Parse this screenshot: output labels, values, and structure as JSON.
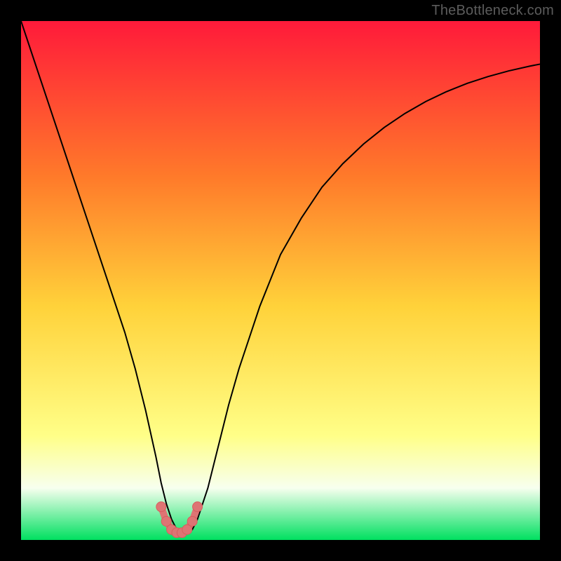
{
  "watermark": "TheBottleneck.com",
  "colors": {
    "frame": "#000000",
    "watermark_text": "#5c5c5c",
    "gradient_top": "#ff1a3a",
    "gradient_mid_upper": "#ff7a2a",
    "gradient_mid": "#ffd23a",
    "gradient_mid_lower": "#ffff88",
    "gradient_lower_band": "#f7ffef",
    "gradient_bottom": "#00e060",
    "curve_main": "#000000",
    "marker_fill": "#de7474",
    "marker_stroke": "#d85e5e"
  },
  "chart_data": {
    "type": "line",
    "title": "",
    "xlabel": "",
    "ylabel": "",
    "xlim": [
      0,
      100
    ],
    "ylim": [
      0,
      100
    ],
    "series": [
      {
        "name": "bottleneck-curve",
        "x": [
          0,
          2,
          4,
          6,
          8,
          10,
          12,
          14,
          16,
          18,
          20,
          22,
          24,
          26,
          27,
          28,
          29,
          30,
          31,
          32,
          33,
          34,
          36,
          38,
          40,
          42,
          44,
          46,
          48,
          50,
          54,
          58,
          62,
          66,
          70,
          74,
          78,
          82,
          86,
          90,
          94,
          98,
          100
        ],
        "y": [
          100,
          94,
          88,
          82,
          76,
          70,
          64,
          58,
          52,
          46,
          40,
          33,
          25,
          16,
          11,
          7,
          4,
          2,
          1.2,
          1.2,
          2,
          4,
          10,
          18,
          26,
          33,
          39,
          45,
          50,
          55,
          62,
          68,
          72.5,
          76.3,
          79.5,
          82.2,
          84.5,
          86.4,
          88.0,
          89.3,
          90.4,
          91.3,
          91.7
        ]
      },
      {
        "name": "bottom-overlay-markers",
        "x": [
          27,
          28,
          29,
          30,
          31,
          32,
          33,
          34
        ],
        "y": [
          6.4,
          3.6,
          2.0,
          1.4,
          1.4,
          2.0,
          3.6,
          6.4
        ]
      }
    ],
    "gradient_stops": [
      {
        "offset": 0.0,
        "color_key": "gradient_top"
      },
      {
        "offset": 0.3,
        "color_key": "gradient_mid_upper"
      },
      {
        "offset": 0.55,
        "color_key": "gradient_mid"
      },
      {
        "offset": 0.8,
        "color_key": "gradient_mid_lower"
      },
      {
        "offset": 0.9,
        "color_key": "gradient_lower_band"
      },
      {
        "offset": 1.0,
        "color_key": "gradient_bottom"
      }
    ]
  }
}
